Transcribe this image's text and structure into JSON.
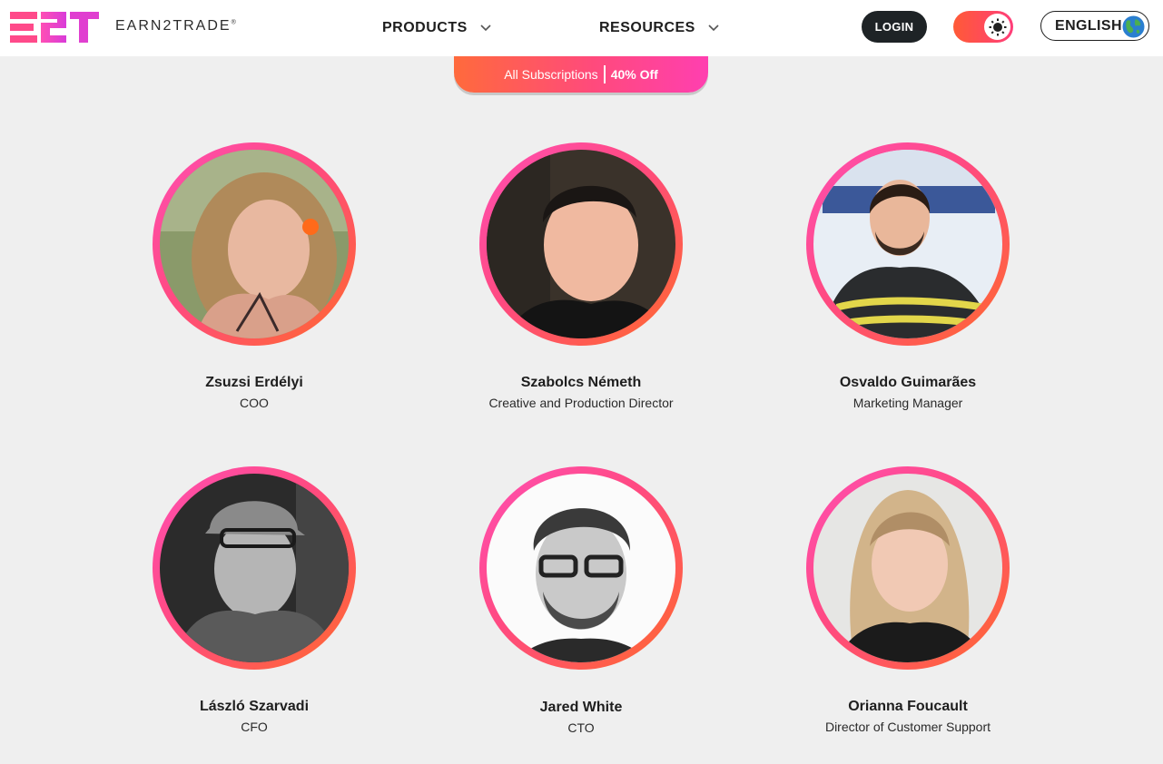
{
  "header": {
    "logo_text": "EARN2TRADE",
    "logo_mark": "E2T",
    "nav": [
      {
        "label": "PRODUCTS"
      },
      {
        "label": "RESOURCES"
      }
    ],
    "login_label": "LOGIN",
    "language_label": "ENGLISH"
  },
  "promo": {
    "text": "All Subscriptions",
    "discount": "40% Off"
  },
  "team": [
    {
      "name": "Zsuzsi Erdélyi",
      "role": "COO"
    },
    {
      "name": "Szabolcs Németh",
      "role": "Creative and Production Director"
    },
    {
      "name": "Osvaldo Guimarães",
      "role": "Marketing Manager"
    },
    {
      "name": "László Szarvadi",
      "role": "CFO"
    },
    {
      "name": "Jared White",
      "role": "CTO"
    },
    {
      "name": "Orianna Foucault",
      "role": "Director of Customer Support"
    }
  ],
  "colors": {
    "accent_pink": "#ff3fb0",
    "accent_orange": "#ff6a2b",
    "dark": "#1e2326",
    "background": "#efefef"
  },
  "icons": [
    "chevron-down-icon",
    "sun-icon",
    "globe-icon"
  ]
}
